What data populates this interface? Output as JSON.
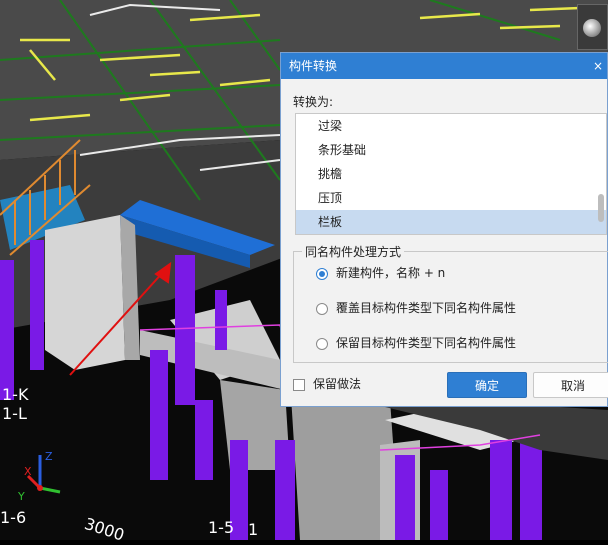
{
  "dialog": {
    "title": "构件转换",
    "convert_to_label": "转换为:",
    "list_items": [
      "过梁",
      "条形基础",
      "挑檐",
      "压顶",
      "栏板"
    ],
    "selected_item": "栏板",
    "group_title": "同名构件处理方式",
    "options": [
      "新建构件，名称 + n",
      "覆盖目标构件类型下同名构件属性",
      "保留目标构件类型下同名构件属性"
    ],
    "selected_option": 0,
    "keep_method_label": "保留做法",
    "keep_method_checked": false,
    "ok_label": "确定",
    "cancel_label": "取消",
    "close_symbol": "×"
  },
  "viewport": {
    "axis_labels": {
      "k": "1-K",
      "l": "1-L",
      "six": "1-6",
      "dim": "3000",
      "five": "1-5",
      "one": "1"
    },
    "colors": {
      "slab": "#505050",
      "column": "#7a1ae6",
      "beam": "#cfcfcf",
      "grid": "#1e7a1e",
      "rebar_yellow": "#e8e84a",
      "arrow": "#e01010",
      "stair": "#1f8fd6"
    }
  }
}
